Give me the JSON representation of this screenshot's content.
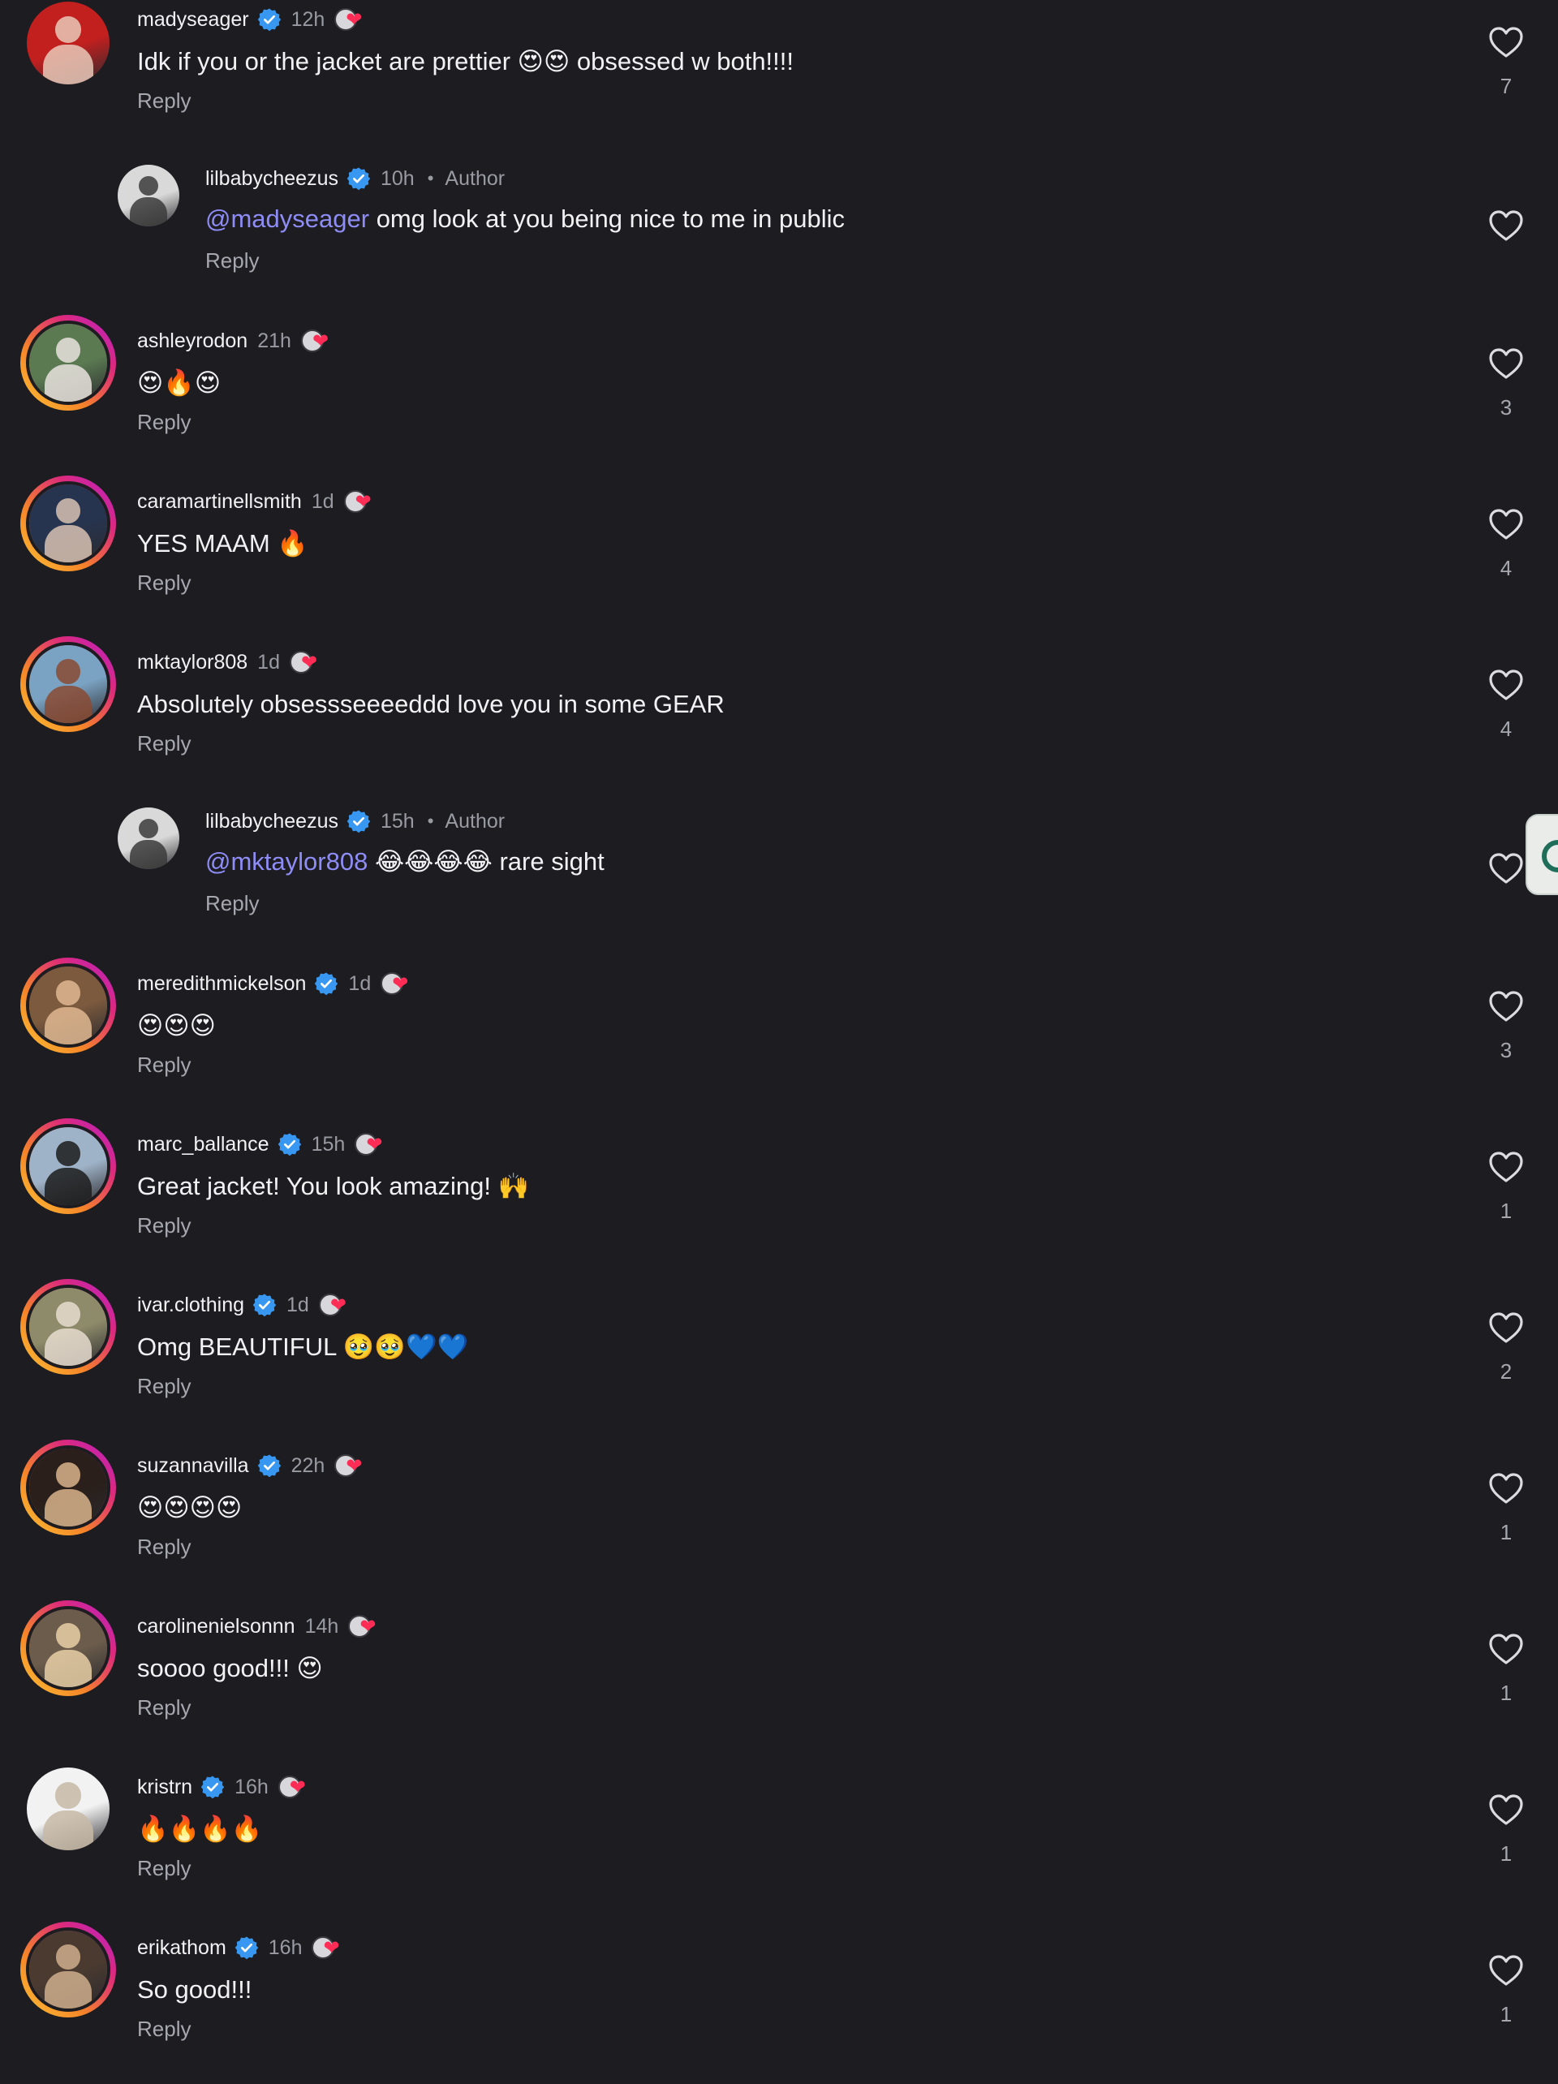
{
  "comments": [
    {
      "username": "madyseager",
      "verified": true,
      "time": "12h",
      "author_badge": "",
      "mention": "",
      "text": "Idk if you or the jacket are prettier 😍😍 obsessed w both!!!!",
      "reply_label": "Reply",
      "likes": "7",
      "creator_liked": true,
      "is_reply": false,
      "has_story_ring": false,
      "avatar_colors": [
        "#c21f1f",
        "#e8c9b8"
      ]
    },
    {
      "username": "lilbabycheezus",
      "verified": true,
      "time": "10h",
      "author_badge": "Author",
      "mention": "@madyseager",
      "text": "omg look at you being nice to me in public",
      "reply_label": "Reply",
      "likes": "",
      "creator_liked": false,
      "is_reply": true,
      "has_story_ring": false,
      "avatar_colors": [
        "#d9d9d9",
        "#3b3b3b"
      ]
    },
    {
      "username": "ashleyrodon",
      "verified": false,
      "time": "21h",
      "author_badge": "",
      "mention": "",
      "text": "😍🔥😍",
      "reply_label": "Reply",
      "likes": "3",
      "creator_liked": true,
      "is_reply": false,
      "has_story_ring": true,
      "avatar_colors": [
        "#5b7a52",
        "#e9e3de"
      ]
    },
    {
      "username": "caramartinellsmith",
      "verified": false,
      "time": "1d",
      "author_badge": "",
      "mention": "",
      "text": "YES MAAM 🔥",
      "reply_label": "Reply",
      "likes": "4",
      "creator_liked": true,
      "is_reply": false,
      "has_story_ring": true,
      "avatar_colors": [
        "#27344f",
        "#d8c2b3"
      ]
    },
    {
      "username": "mktaylor808",
      "verified": false,
      "time": "1d",
      "author_badge": "",
      "mention": "",
      "text": "Absolutely obsessseeeeddd love you in some GEAR",
      "reply_label": "Reply",
      "likes": "4",
      "creator_liked": true,
      "is_reply": false,
      "has_story_ring": true,
      "avatar_colors": [
        "#7aa2c2",
        "#8a4a32"
      ]
    },
    {
      "username": "lilbabycheezus",
      "verified": true,
      "time": "15h",
      "author_badge": "Author",
      "mention": "@mktaylor808",
      "text": "😂😂😂😂 rare sight",
      "reply_label": "Reply",
      "likes": "",
      "creator_liked": false,
      "is_reply": true,
      "has_story_ring": false,
      "avatar_colors": [
        "#d9d9d9",
        "#3b3b3b"
      ]
    },
    {
      "username": "meredithmickelson",
      "verified": true,
      "time": "1d",
      "author_badge": "",
      "mention": "",
      "text": "😍😍😍",
      "reply_label": "Reply",
      "likes": "3",
      "creator_liked": true,
      "is_reply": false,
      "has_story_ring": true,
      "avatar_colors": [
        "#7c5a3e",
        "#e0b992"
      ]
    },
    {
      "username": "marc_ballance",
      "verified": true,
      "time": "15h",
      "author_badge": "",
      "mention": "",
      "text": "Great jacket! You look amazing! 🙌",
      "reply_label": "Reply",
      "likes": "1",
      "creator_liked": true,
      "is_reply": false,
      "has_story_ring": true,
      "avatar_colors": [
        "#9fb3c8",
        "#1c1c1c"
      ]
    },
    {
      "username": "ivar.clothing",
      "verified": true,
      "time": "1d",
      "author_badge": "",
      "mention": "",
      "text": "Omg BEAUTIFUL 🥹🥹💙💙",
      "reply_label": "Reply",
      "likes": "2",
      "creator_liked": true,
      "is_reply": false,
      "has_story_ring": true,
      "avatar_colors": [
        "#8e8b6a",
        "#e6dccf"
      ]
    },
    {
      "username": "suzannavilla",
      "verified": true,
      "time": "22h",
      "author_badge": "",
      "mention": "",
      "text": "😍😍😍😍",
      "reply_label": "Reply",
      "likes": "1",
      "creator_liked": true,
      "is_reply": false,
      "has_story_ring": true,
      "avatar_colors": [
        "#2a1f1a",
        "#d9b48c"
      ]
    },
    {
      "username": "carolinenielsonnn",
      "verified": false,
      "time": "14h",
      "author_badge": "",
      "mention": "",
      "text": "soooo good!!! 😍",
      "reply_label": "Reply",
      "likes": "1",
      "creator_liked": true,
      "is_reply": false,
      "has_story_ring": true,
      "avatar_colors": [
        "#6b5c4b",
        "#e8cfa6"
      ]
    },
    {
      "username": "kristrn",
      "verified": true,
      "time": "16h",
      "author_badge": "",
      "mention": "",
      "text": "🔥🔥🔥🔥",
      "reply_label": "Reply",
      "likes": "1",
      "creator_liked": true,
      "is_reply": false,
      "has_story_ring": false,
      "avatar_colors": [
        "#f2f2f2",
        "#c7b8a6"
      ]
    },
    {
      "username": "erikathom",
      "verified": true,
      "time": "16h",
      "author_badge": "",
      "mention": "",
      "text": "So good!!!",
      "reply_label": "Reply",
      "likes": "1",
      "creator_liked": true,
      "is_reply": false,
      "has_story_ring": true,
      "avatar_colors": [
        "#4a3a30",
        "#cfae8c"
      ]
    }
  ],
  "icons": {
    "verified_badge_color": "#3897f0",
    "like_icon": "heart-outline-icon",
    "creator_like_icon": "creator-liked-icon"
  }
}
